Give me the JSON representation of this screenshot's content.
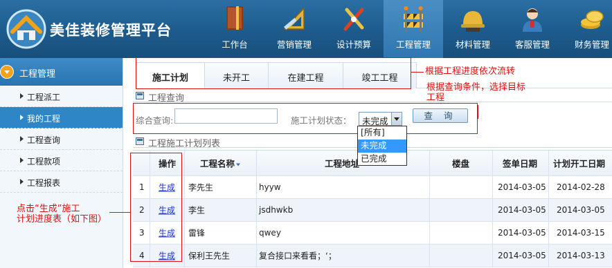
{
  "header": {
    "app_title": "美佳装修管理平台",
    "nav": [
      {
        "label": "工作台",
        "icon": "book-icon",
        "active": false
      },
      {
        "label": "营销管理",
        "icon": "ruler-triangle-icon",
        "active": false
      },
      {
        "label": "设计预算",
        "icon": "design-tools-icon",
        "active": false
      },
      {
        "label": "工程管理",
        "icon": "construction-barrier-icon",
        "active": true
      },
      {
        "label": "材料管理",
        "icon": "hard-hat-icon",
        "active": false
      },
      {
        "label": "客服管理",
        "icon": "service-agent-icon",
        "active": false
      },
      {
        "label": "财务管理",
        "icon": "gold-coins-icon",
        "active": false
      }
    ]
  },
  "sidebar": {
    "title": "工程管理",
    "items": [
      {
        "label": "工程派工",
        "active": false
      },
      {
        "label": "我的工程",
        "active": true
      },
      {
        "label": "工程查询",
        "active": false
      },
      {
        "label": "工程款项",
        "active": false
      },
      {
        "label": "工程报表",
        "active": false
      }
    ]
  },
  "tabs": [
    "施工计划",
    "未开工",
    "在建工程",
    "竣工工程"
  ],
  "query": {
    "section_title": "工程查询",
    "keyword_label": "综合查询:",
    "keyword_value": "",
    "status_label": "施工计划状态：",
    "status_value": "未完成",
    "status_options": [
      "[所有]",
      "未完成",
      "已完成"
    ],
    "search_button": "查 询"
  },
  "list": {
    "section_title": "工程施工计划列表",
    "columns": [
      "操作",
      "工程名称",
      "工程地址",
      "楼盘",
      "签单日期",
      "计划开工日期"
    ],
    "rows": [
      {
        "no": "1",
        "action": "生成",
        "name": "李先生",
        "address": "hyyw",
        "estate": "",
        "sign_date": "2014-03-05",
        "start_date": "2014-02-28"
      },
      {
        "no": "2",
        "action": "生成",
        "name": "李生",
        "address": "jsdhwkb",
        "estate": "",
        "sign_date": "2014-03-05",
        "start_date": "2014-03-05"
      },
      {
        "no": "3",
        "action": "生成",
        "name": "雷锋",
        "address": "qwey",
        "estate": "",
        "sign_date": "2014-03-05",
        "start_date": "2014-03-15"
      },
      {
        "no": "4",
        "action": "生成",
        "name": "保利王先生",
        "address": "复合接口来看看；‘；",
        "estate": "",
        "sign_date": "2014-03-05",
        "start_date": "2014-03-13"
      }
    ]
  },
  "annotations": {
    "tabs_note": "根据工程进度依次流转",
    "query_note_line1": "根据查询条件，选择目标",
    "query_note_line2": "工程",
    "action_note_line1": "点击“生成”施工",
    "action_note_line2": "计划进度表（如下图）"
  },
  "colors": {
    "header_blue": "#1d5b8c",
    "active_blue": "#2f86c7",
    "annotation_red": "#e01010",
    "link_blue": "#1a33c9"
  }
}
